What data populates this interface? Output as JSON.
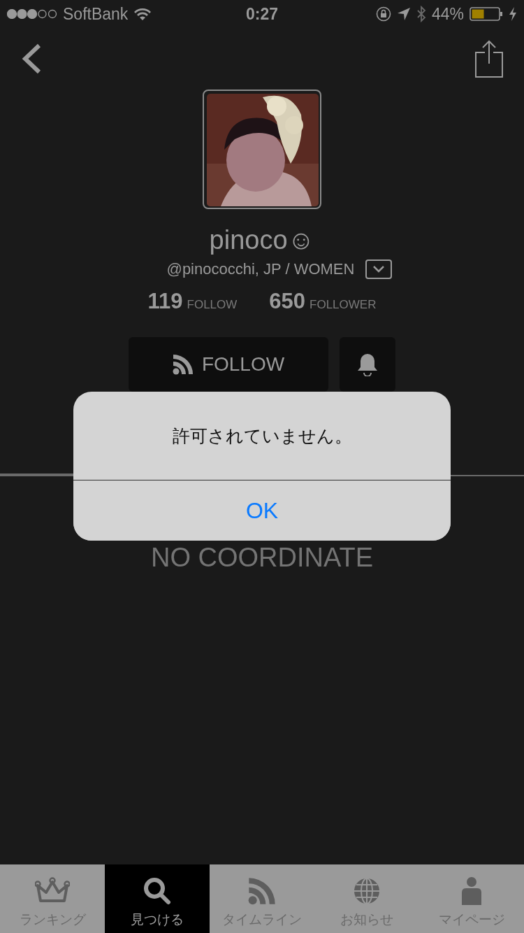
{
  "status_bar": {
    "carrier": "SoftBank",
    "time": "0:27",
    "battery": "44%"
  },
  "profile": {
    "name": "pinoco☺",
    "handle": "@pinococchi, JP / WOMEN",
    "stats": [
      {
        "value": "119",
        "label": "FOLLOW"
      },
      {
        "value": "650",
        "label": "FOLLOWER"
      }
    ],
    "follow_button": "FOLLOW"
  },
  "empty_message": "NO COORDINATE",
  "alert": {
    "message": "許可されていません。",
    "button": "OK"
  },
  "tab_bar": [
    {
      "kind": "crown",
      "label": "ランキング",
      "selected": false
    },
    {
      "kind": "search",
      "label": "見つける",
      "selected": true
    },
    {
      "kind": "feed",
      "label": "タイムライン",
      "selected": false
    },
    {
      "kind": "globe",
      "label": "お知らせ",
      "selected": false
    },
    {
      "kind": "person",
      "label": "マイページ",
      "selected": false
    }
  ]
}
